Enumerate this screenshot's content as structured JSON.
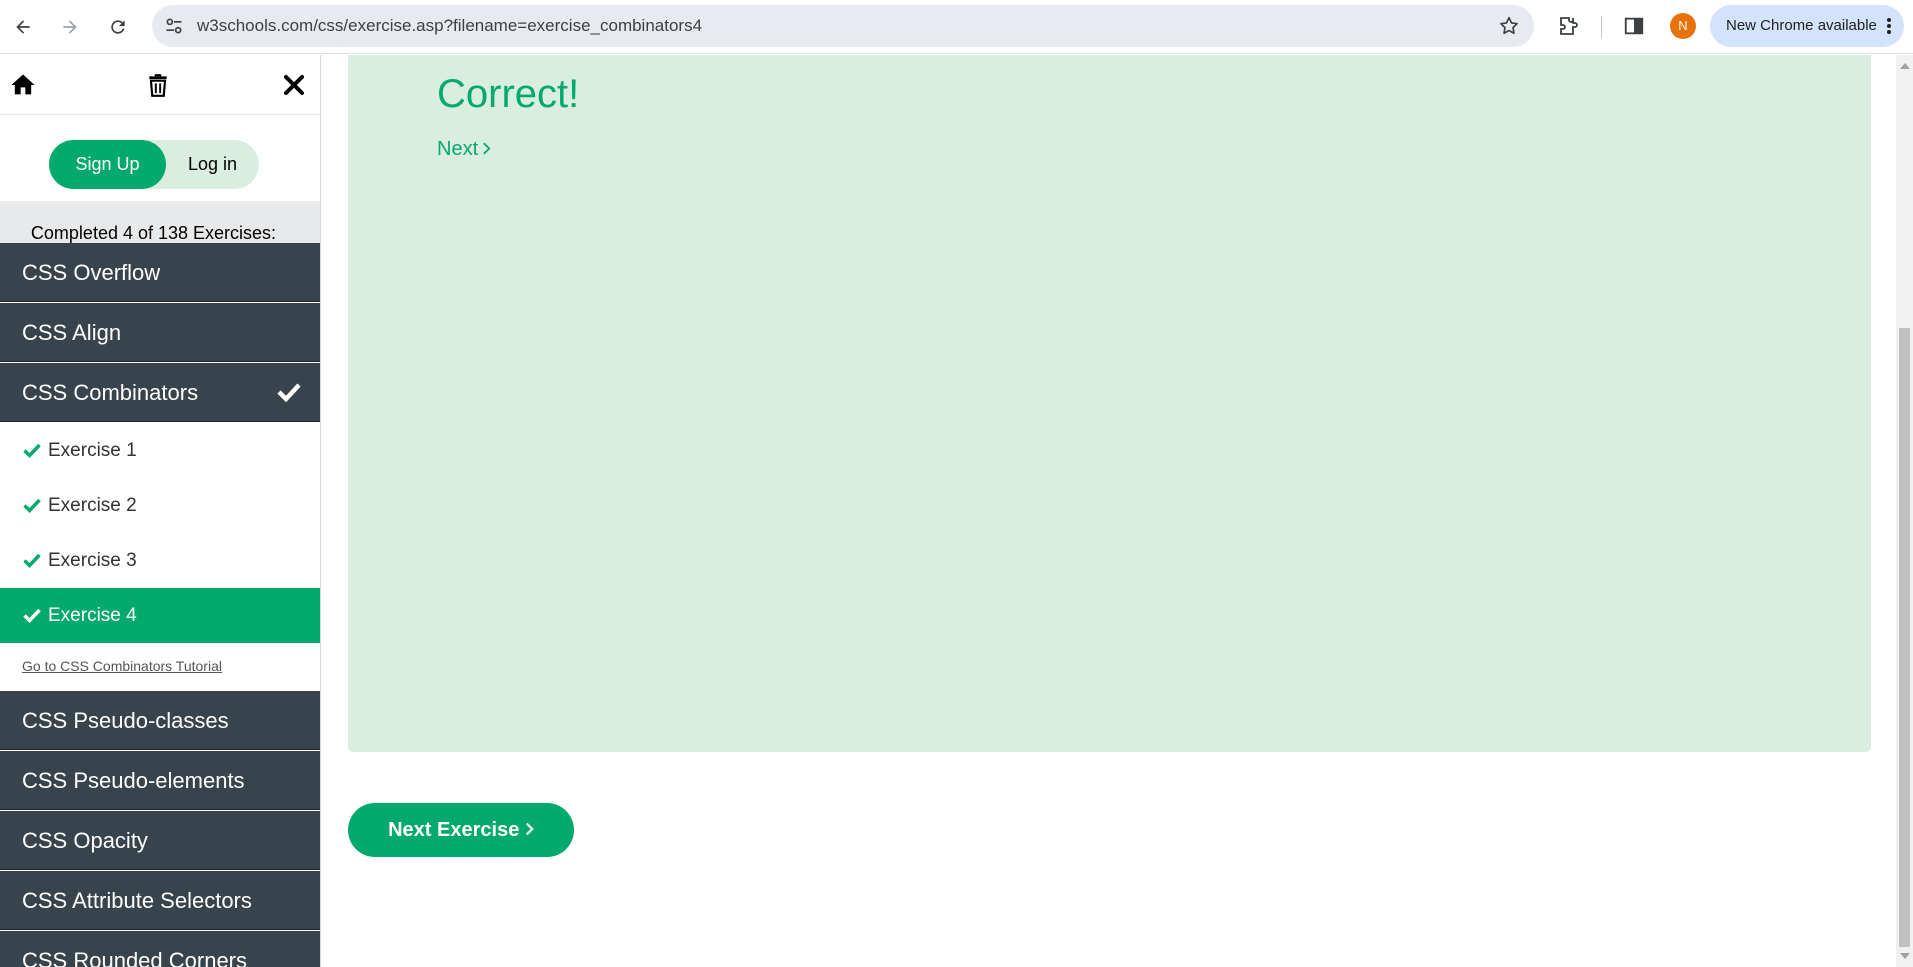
{
  "browser": {
    "url": "w3schools.com/css/exercise.asp?filename=exercise_combinators4",
    "profile_initial": "N",
    "update_label": "New Chrome available",
    "icons": [
      "back-arrow-icon",
      "forward-arrow-icon",
      "reload-icon",
      "site-settings-icon",
      "bookmark-star-icon",
      "extensions-icon",
      "side-panel-icon",
      "more-vert-icon"
    ]
  },
  "sidebar": {
    "top_icons": [
      "home-icon",
      "trash-icon",
      "close-icon"
    ],
    "auth": {
      "signup_label": "Sign Up",
      "login_label": "Log in"
    },
    "progress_text": "Completed 4 of 138 Exercises:",
    "topics_before": [
      {
        "label": "CSS Overflow"
      },
      {
        "label": "CSS Align"
      }
    ],
    "active_topic": {
      "label": "CSS Combinators",
      "completed": true
    },
    "exercises": [
      {
        "label": "Exercise 1",
        "completed": true,
        "active": false
      },
      {
        "label": "Exercise 2",
        "completed": true,
        "active": false
      },
      {
        "label": "Exercise 3",
        "completed": true,
        "active": false
      },
      {
        "label": "Exercise 4",
        "completed": true,
        "active": true
      }
    ],
    "tutorial_link": "Go to CSS Combinators Tutorial",
    "topics_after": [
      {
        "label": "CSS Pseudo-classes"
      },
      {
        "label": "CSS Pseudo-elements"
      },
      {
        "label": "CSS Opacity"
      },
      {
        "label": "CSS Attribute Selectors"
      },
      {
        "label": "CSS Rounded Corners"
      }
    ]
  },
  "main": {
    "result_title": "Correct!",
    "next_link_label": "Next",
    "next_exercise_label": "Next Exercise"
  },
  "colors": {
    "brand_green": "#04aa6d",
    "light_green": "#d9eee1",
    "sidebar_dark": "#38444d",
    "progress_gray": "#e7e9eb"
  }
}
